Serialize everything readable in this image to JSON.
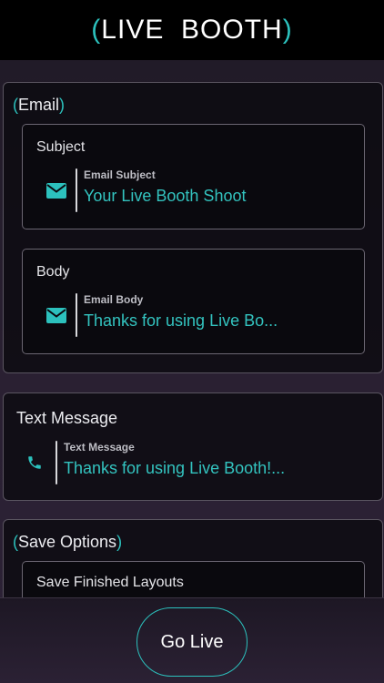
{
  "header": {
    "title_open": "(",
    "title_word1": "LIVE",
    "title_word2": "BOOTH",
    "title_close": ")"
  },
  "email_section": {
    "title_open": "(",
    "title": "Email",
    "title_close": ")",
    "subject_card": {
      "label": "Subject",
      "icon": "envelope-icon",
      "caption": "Email Subject",
      "value": "Your Live Booth Shoot"
    },
    "body_card": {
      "label": "Body",
      "icon": "envelope-icon",
      "caption": "Email Body",
      "value": "Thanks for using Live Bo..."
    }
  },
  "text_section": {
    "title": "Text Message",
    "icon": "phone-icon",
    "caption": "Text Message",
    "value": "Thanks for using Live Booth!..."
  },
  "save_section": {
    "title_open": "(",
    "title": "Save Options",
    "title_close": ")",
    "first_card_label": "Save Finished Layouts"
  },
  "footer": {
    "go_live_label": "Go Live"
  },
  "colors": {
    "accent": "#2cc1bd",
    "background": "#1f1a26",
    "header": "#000000"
  }
}
